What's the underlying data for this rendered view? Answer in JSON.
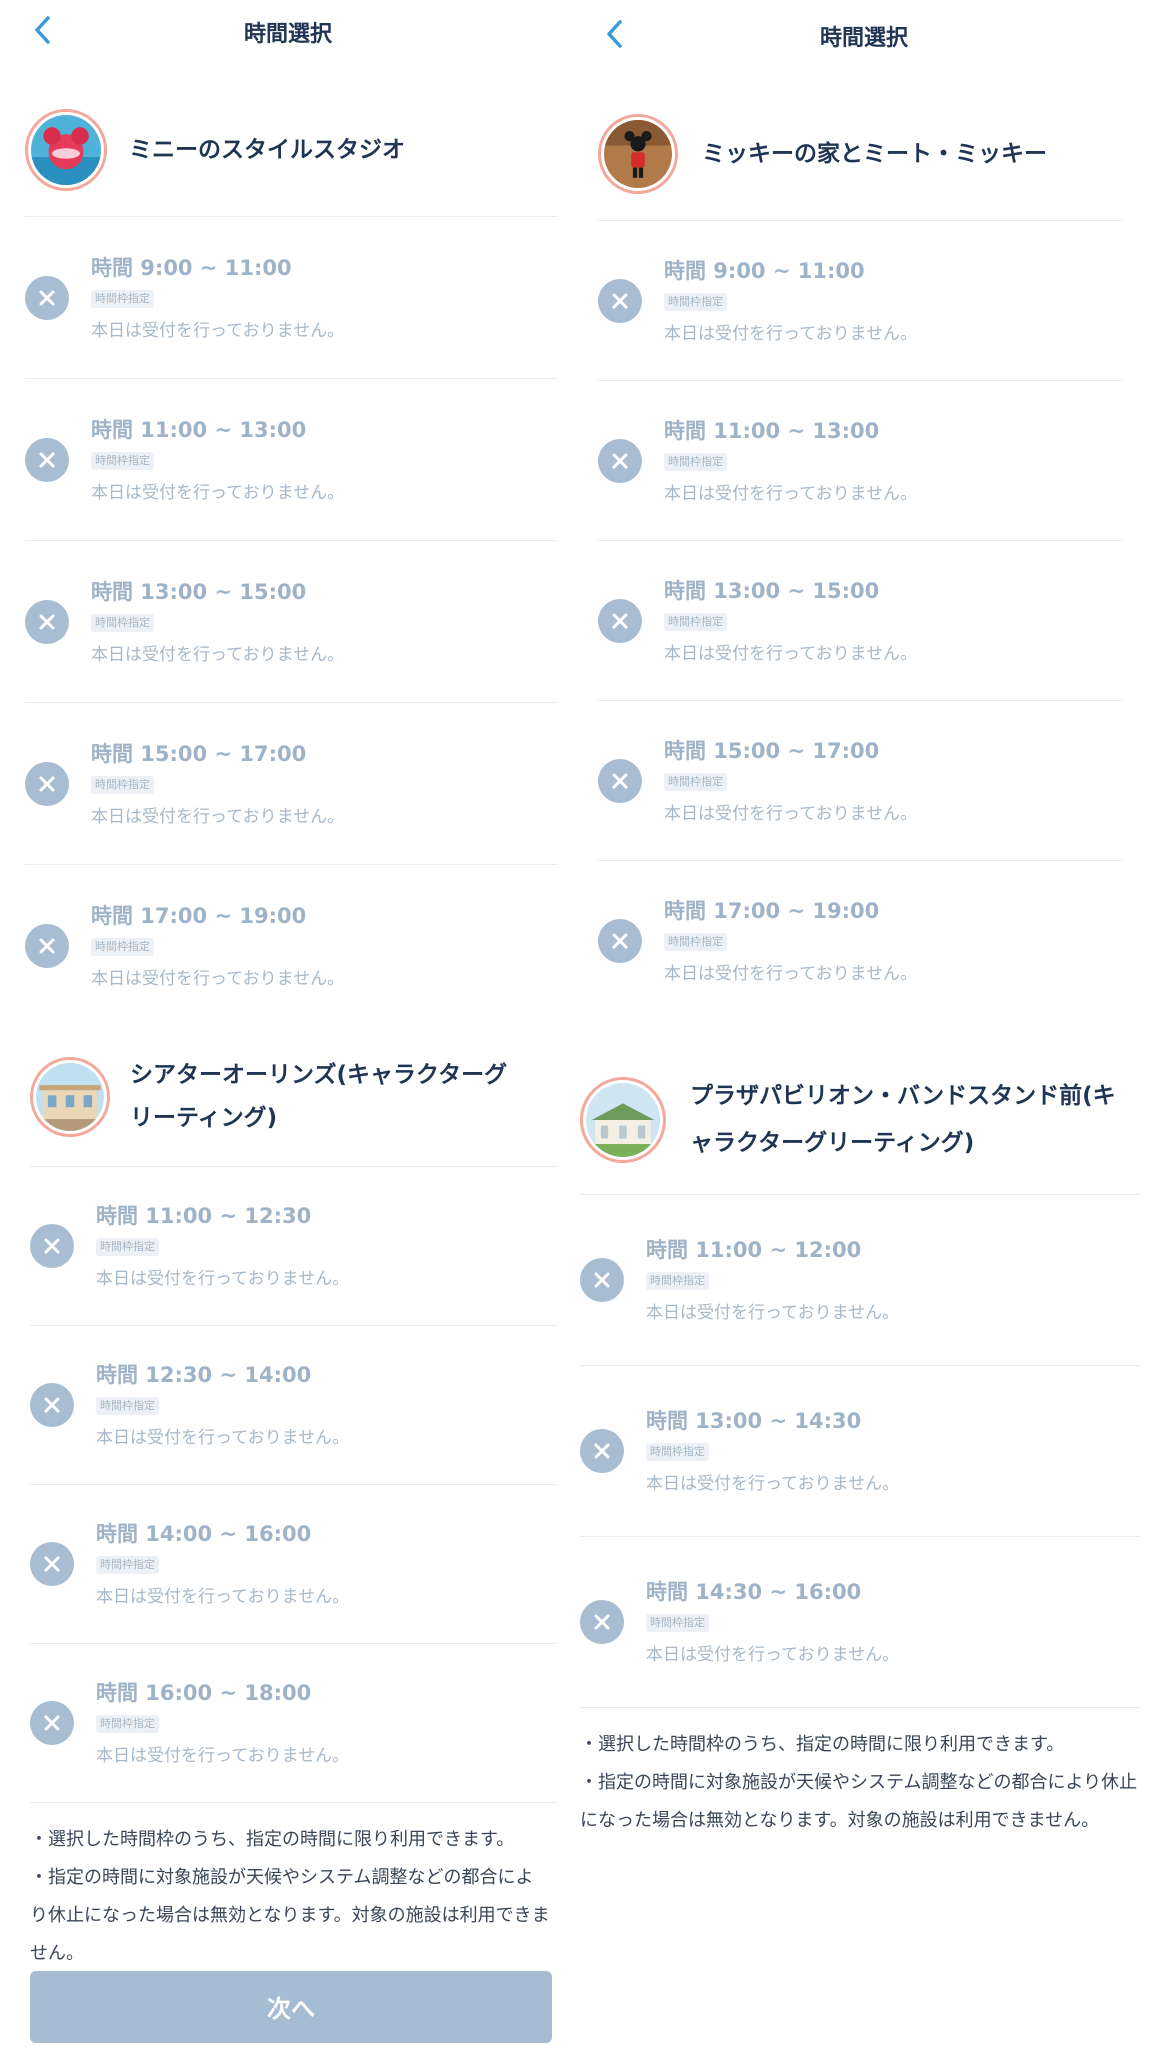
{
  "left": {
    "header": {
      "title": "時間選択"
    },
    "facilities": [
      {
        "name": "ミニーのスタイルスタジオ",
        "slots": [
          {
            "time": "時間 9:00 ~ 11:00",
            "tag": "時間枠指定",
            "status": "本日は受付を行っておりません。"
          },
          {
            "time": "時間 11:00 ~ 13:00",
            "tag": "時間枠指定",
            "status": "本日は受付を行っておりません。"
          },
          {
            "time": "時間 13:00 ~ 15:00",
            "tag": "時間枠指定",
            "status": "本日は受付を行っておりません。"
          },
          {
            "time": "時間 15:00 ~ 17:00",
            "tag": "時間枠指定",
            "status": "本日は受付を行っておりません。"
          },
          {
            "time": "時間 17:00 ~ 19:00",
            "tag": "時間枠指定",
            "status": "本日は受付を行っておりません。"
          }
        ]
      },
      {
        "name": "シアターオーリンズ(キャラクターグリーティング)",
        "slots": [
          {
            "time": "時間 11:00 ~ 12:30",
            "tag": "時間枠指定",
            "status": "本日は受付を行っておりません。"
          },
          {
            "time": "時間 12:30 ~ 14:00",
            "tag": "時間枠指定",
            "status": "本日は受付を行っておりません。"
          },
          {
            "time": "時間 14:00 ~ 16:00",
            "tag": "時間枠指定",
            "status": "本日は受付を行っておりません。"
          },
          {
            "time": "時間 16:00 ~ 18:00",
            "tag": "時間枠指定",
            "status": "本日は受付を行っておりません。"
          }
        ]
      }
    ],
    "notes": [
      "・選択した時間枠のうち、指定の時間に限り利用できます。",
      "・指定の時間に対象施設が天候やシステム調整などの都合により休止になった場合は無効となります。対象の施設は利用できません。"
    ],
    "next_button": "次へ"
  },
  "right": {
    "header": {
      "title": "時間選択"
    },
    "facilities": [
      {
        "name": "ミッキーの家とミート・ミッキー",
        "slots": [
          {
            "time": "時間 9:00 ~ 11:00",
            "tag": "時間枠指定",
            "status": "本日は受付を行っておりません。"
          },
          {
            "time": "時間 11:00 ~ 13:00",
            "tag": "時間枠指定",
            "status": "本日は受付を行っておりません。"
          },
          {
            "time": "時間 13:00 ~ 15:00",
            "tag": "時間枠指定",
            "status": "本日は受付を行っておりません。"
          },
          {
            "time": "時間 15:00 ~ 17:00",
            "tag": "時間枠指定",
            "status": "本日は受付を行っておりません。"
          },
          {
            "time": "時間 17:00 ~ 19:00",
            "tag": "時間枠指定",
            "status": "本日は受付を行っておりません。"
          }
        ]
      },
      {
        "name": "プラザパビリオン・バンドスタンド前(キャラクターグリーティング)",
        "slots": [
          {
            "time": "時間 11:00 ~ 12:00",
            "tag": "時間枠指定",
            "status": "本日は受付を行っておりません。"
          },
          {
            "time": "時間 13:00 ~ 14:30",
            "tag": "時間枠指定",
            "status": "本日は受付を行っておりません。"
          },
          {
            "time": "時間 14:30 ~ 16:00",
            "tag": "時間枠指定",
            "status": "本日は受付を行っておりません。"
          }
        ]
      }
    ],
    "notes": [
      "・選択した時間枠のうち、指定の時間に限り利用できます。",
      "・指定の時間に対象施設が天候やシステム調整などの都合により休止になった場合は無効となります。対象の施設は利用できません。"
    ]
  },
  "colors": {
    "accent": "#3a9ad9",
    "title": "#1f3553",
    "disabled_text": "#9fb3c8",
    "disabled_icon": "#a9bdd2",
    "divider": "#e7ebf0",
    "thumb_border": "#f3a89a",
    "next_button": "#a6bcd2"
  },
  "icons": {
    "back": "chevron-left-icon",
    "unavailable": "close-circle-icon"
  }
}
